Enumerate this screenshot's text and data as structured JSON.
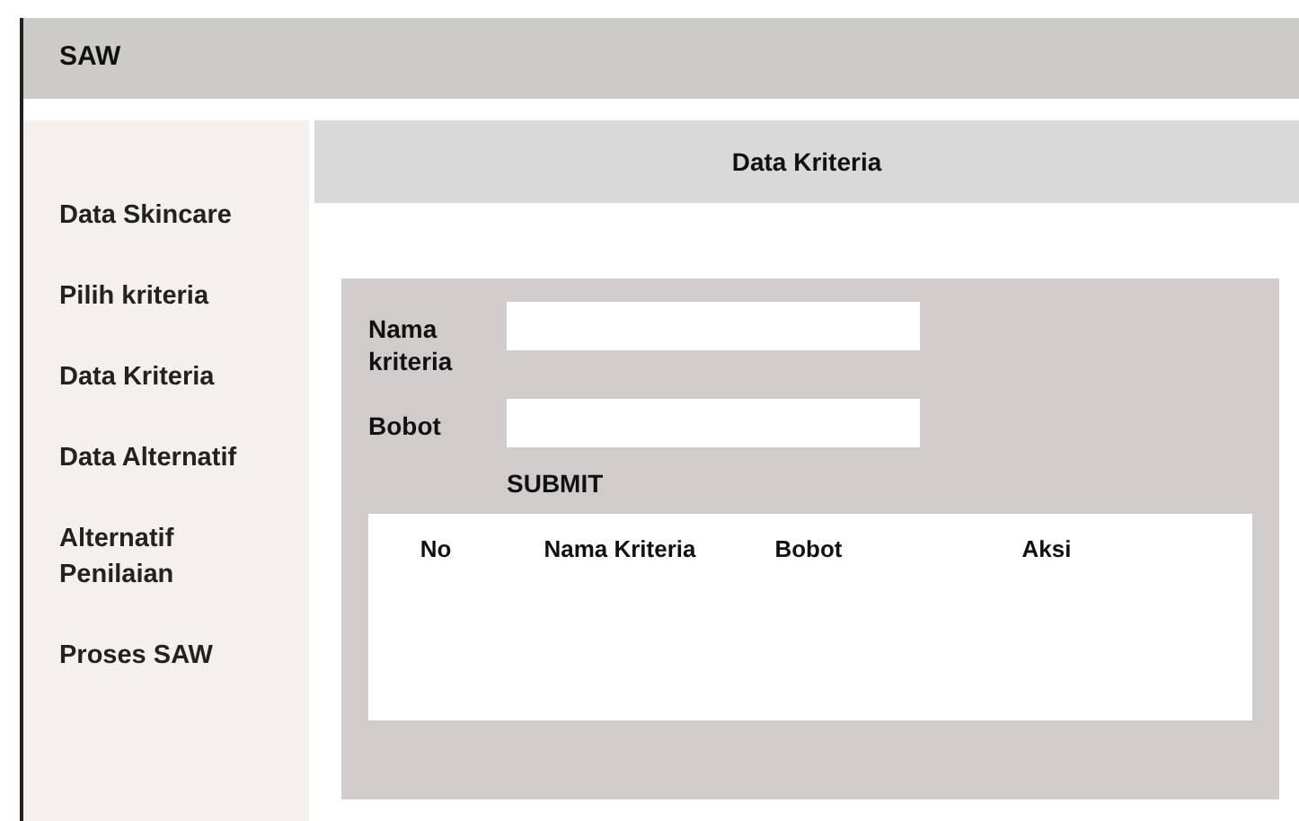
{
  "app_bar": {
    "title": "SAW"
  },
  "sidebar": {
    "items": [
      {
        "label": "Data Skincare"
      },
      {
        "label": "Pilih kriteria"
      },
      {
        "label": "Data Kriteria"
      },
      {
        "label": "Data Alternatif"
      },
      {
        "label": "Alternatif Penilaian"
      },
      {
        "label": "Proses SAW"
      }
    ]
  },
  "header": {
    "title": "Data Kriteria"
  },
  "form": {
    "fields": [
      {
        "label": "Nama kriteria"
      },
      {
        "label": "Bobot"
      }
    ],
    "submit": "SUBMIT"
  },
  "table": {
    "columns": [
      "No",
      "Nama Kriteria",
      "Bobot",
      "Aksi"
    ]
  }
}
